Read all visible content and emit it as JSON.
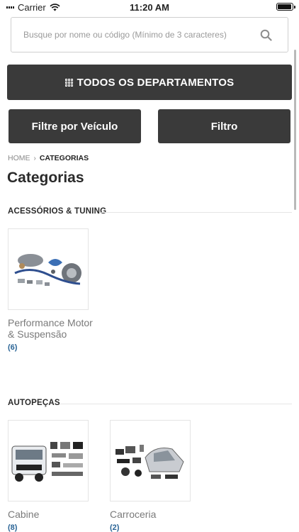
{
  "status_bar": {
    "carrier": "Carrier",
    "time": "11:20 AM"
  },
  "search": {
    "placeholder": "Busque por nome ou código (Mínimo de 3 caracteres)"
  },
  "buttons": {
    "departments": "TODOS OS DEPARTAMENTOS",
    "filter_vehicle": "Filtre por Veículo",
    "filter": "Filtro"
  },
  "breadcrumb": {
    "home": "HOME",
    "separator": "›",
    "current": "CATEGORIAS"
  },
  "page_title": "Categorias",
  "sections": [
    {
      "title": "ACESSÓRIOS & TUNING",
      "categories": [
        {
          "name": "Performance Motor & Suspensão",
          "count": "(6)",
          "image": "turbo-kit-image"
        }
      ]
    },
    {
      "title": "AUTOPEÇAS",
      "categories": [
        {
          "name": "Cabine",
          "count": "(8)",
          "image": "truck-cabin-image"
        },
        {
          "name": "Carroceria",
          "count": "(2)",
          "image": "car-body-parts-image"
        }
      ]
    }
  ],
  "colors": {
    "button_bg": "#3a3a3a",
    "count_link": "#2a6496",
    "muted_text": "#7a7a7a"
  }
}
